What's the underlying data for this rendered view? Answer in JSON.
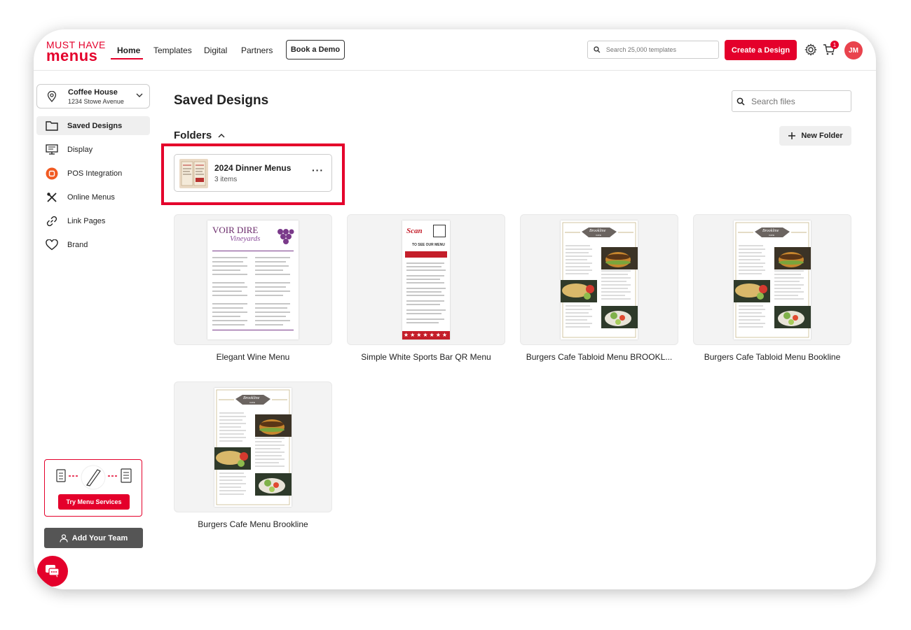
{
  "brand": {
    "line1": "MUST HAVE",
    "line2": "menus",
    "accent": "#e4002b"
  },
  "nav": {
    "links": [
      "Home",
      "Templates",
      "Digital",
      "Partners"
    ],
    "active": "Home",
    "demo_label": "Book a Demo",
    "search_placeholder": "Search 25,000 templates",
    "create_label": "Create a Design",
    "cart_count": "1",
    "avatar_initials": "JM"
  },
  "location": {
    "name": "Coffee House",
    "address": "1234 Stowe Avenue"
  },
  "sidebar": {
    "items": [
      {
        "label": "Saved Designs",
        "icon": "folder-icon"
      },
      {
        "label": "Display",
        "icon": "display-icon"
      },
      {
        "label": "POS Integration",
        "icon": "pos-icon"
      },
      {
        "label": "Online Menus",
        "icon": "utensils-icon"
      },
      {
        "label": "Link Pages",
        "icon": "link-icon"
      },
      {
        "label": "Brand",
        "icon": "heart-icon"
      }
    ],
    "active_index": 0,
    "promo_button": "Try Menu Services",
    "team_button": "Add Your Team"
  },
  "main": {
    "title": "Saved Designs",
    "file_search_placeholder": "Search files",
    "folders_heading": "Folders",
    "new_folder_label": "New Folder",
    "folders": [
      {
        "name": "2024 Dinner Menus",
        "count": "3 items"
      }
    ],
    "designs": [
      {
        "name": "Elegant Wine Menu",
        "thumb_heading": "VOIR DIRE",
        "thumb_sub": "Vineyards"
      },
      {
        "name": "Simple White Sports Bar QR Menu",
        "thumb_heading": "Scan",
        "thumb_sub": "TO SEE OUR MENU"
      },
      {
        "name": "Burgers Cafe Tabloid Menu BROOKL...",
        "thumb_heading": "Brookline",
        "thumb_sub": "CAFE"
      },
      {
        "name": "Burgers Cafe Tabloid Menu Bookline",
        "thumb_heading": "Brookline",
        "thumb_sub": "CAFE"
      },
      {
        "name": "Burgers Cafe Menu Brookline",
        "thumb_heading": "Brookline",
        "thumb_sub": "CAFE"
      }
    ]
  }
}
